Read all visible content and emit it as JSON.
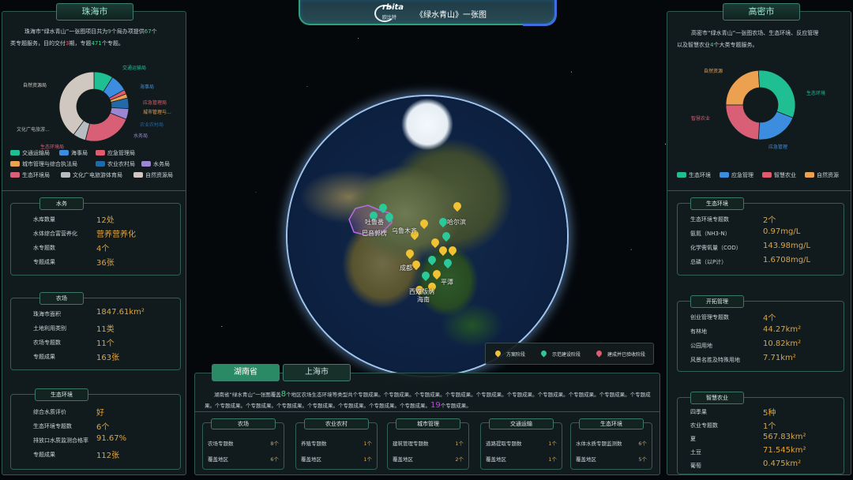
{
  "header": {
    "logo_text": "rbita",
    "logo_sub": "欧比特",
    "title": "《绿水青山》一张图"
  },
  "left": {
    "city_tab": "珠海市",
    "intro": {
      "p1": "珠海市“绿水青山”一张图项目共为",
      "n1": "9",
      "p2": "个局办项提供",
      "n2": "67",
      "p3": "个",
      "p4": "类专题服务，目的交付",
      "n3": "3",
      "p5": "期，专题",
      "n4": "471",
      "p6": "个专题。"
    },
    "pie": {
      "labels": [
        "交通运输局",
        "海事局",
        "应急管理局",
        "城市管理与...",
        "农业农村局",
        "水务局",
        "生态环境局",
        "文化广电旅游...",
        "自然资源局"
      ],
      "values": [
        9,
        8,
        2,
        2,
        5,
        5,
        23,
        6,
        40
      ],
      "colors": [
        "#1fbf93",
        "#3c8de0",
        "#e25b6d",
        "#eba14f",
        "#2169a8",
        "#9b86d4",
        "#d95f77",
        "#b7bdc0",
        "#cfc7c0"
      ]
    },
    "legend": [
      {
        "label": "交通运输局",
        "color": "#1fbf93"
      },
      {
        "label": "海事局",
        "color": "#3c8de0"
      },
      {
        "label": "应急管理局",
        "color": "#e25b6d"
      },
      {
        "label": "城市管理与综合执法局",
        "color": "#eba14f"
      },
      {
        "label": "农业农村局",
        "color": "#2169a8"
      },
      {
        "label": "水务局",
        "color": "#9b86d4"
      },
      {
        "label": "生态环境局",
        "color": "#d95f77"
      },
      {
        "label": "文化广电旅游体育局",
        "color": "#b7bdc0"
      },
      {
        "label": "自然资源局",
        "color": "#cfc7c0"
      }
    ],
    "water": {
      "title": "水务",
      "rows": [
        {
          "label": "水库数量",
          "value": "12处"
        },
        {
          "label": "水体综合富营养化",
          "value": "营养营养化"
        },
        {
          "label": "水专题数",
          "value": "4个"
        },
        {
          "label": "专题成果",
          "value": "36张"
        }
      ]
    },
    "farm": {
      "title": "农场",
      "rows": [
        {
          "label": "珠海市面积",
          "value": "1847.61km²"
        },
        {
          "label": "土地利用类别",
          "value": "11类"
        },
        {
          "label": "农场专题数",
          "value": "11个"
        },
        {
          "label": "专题成果",
          "value": "163张"
        }
      ]
    },
    "eco": {
      "title": "生态环境",
      "rows": [
        {
          "label": "综合水质评价",
          "value": "好"
        },
        {
          "label": "生态环境专题数",
          "value": "6个"
        },
        {
          "label": "排放口水质监测合格率",
          "value": "91.67%"
        },
        {
          "label": "专题成果",
          "value": "112张"
        }
      ]
    }
  },
  "right": {
    "city_tab": "高密市",
    "intro": {
      "p1": "高密市“绿水青山”一张图农场、生态环境、反应管理",
      "p2": "以及智慧农业",
      "n1": "4",
      "p3": "个大类专题服务。"
    },
    "pie": {
      "labels": [
        "自然资源",
        "生态环境",
        "应急管理",
        "智慧农业"
      ],
      "values": [
        24,
        32,
        20,
        24
      ],
      "colors": [
        "#eba14f",
        "#1fbf93",
        "#3c8de0",
        "#d95f77"
      ]
    },
    "legend": [
      {
        "label": "生态环境",
        "color": "#1fbf93"
      },
      {
        "label": "应急管理",
        "color": "#3c8de0"
      },
      {
        "label": "智慧农业",
        "color": "#e25b6d"
      },
      {
        "label": "自然资源",
        "color": "#eba14f"
      }
    ],
    "eco": {
      "title": "生态环境",
      "rows": [
        {
          "label": "生态环境专题数",
          "value": "2个"
        },
        {
          "label": "氨氮（NH3-N）",
          "value": "0.97mg/L"
        },
        {
          "label": "化学需氧量（COD）",
          "value": "143.98mg/L"
        },
        {
          "label": "总磷（以P计）",
          "value": "1.6708mg/L"
        }
      ]
    },
    "mgmt": {
      "title": "开拓管理",
      "rows": [
        {
          "label": "创业管理专题数",
          "value": "4个"
        },
        {
          "label": "有林地",
          "value": "44.27km²"
        },
        {
          "label": "公园用地",
          "value": "10.82km²"
        },
        {
          "label": "风景名胜及特殊用地",
          "value": "7.71km²"
        }
      ]
    },
    "agri": {
      "title": "智慧农业",
      "rows": [
        {
          "label": "四季果",
          "value": "5种"
        },
        {
          "label": "农业专题数",
          "value": "1个"
        },
        {
          "label": "夏",
          "value": "567.83km²"
        },
        {
          "label": "土豆",
          "value": "71.545km²"
        },
        {
          "label": "葡萄",
          "value": "0.475km²"
        }
      ]
    }
  },
  "map": {
    "cities": [
      "吐鲁番",
      "乌鲁木齐",
      "巴音郭楞",
      "哈尔滨",
      "成都",
      "西双版纳",
      "平潭",
      "海南"
    ],
    "legend": [
      "方案阶段",
      "示范建设阶段",
      "建成并已验收阶段"
    ]
  },
  "bottom": {
    "tabs": [
      "湖南省",
      "上海市"
    ],
    "intro": {
      "p1": "湖南省“绿水青山”一张图覆盖",
      "n1": "8",
      "p2": "个地区农场生态环境等类型共个专题成果。个专题成果。个专题成果。个专题成果。个专题成果。个专题成果。个专题成果。个专题成果。个专题成果。个专题成果。个专题成果。个专题成果。个专题成果。个专题成果。个专题成果。个专题成果。个专题成果。",
      "n2": "19",
      "p3": "个专题成果。"
    },
    "cards": [
      {
        "title": "农场",
        "rows": [
          {
            "label": "农场专题数",
            "value": "8个"
          },
          {
            "label": "覆盖地区",
            "value": "6个"
          }
        ]
      },
      {
        "title": "农业农村",
        "rows": [
          {
            "label": "养殖专题数",
            "value": "1个"
          },
          {
            "label": "覆盖地区",
            "value": "1个"
          }
        ]
      },
      {
        "title": "城市管理",
        "rows": [
          {
            "label": "建筑管理专题数",
            "value": "1个"
          },
          {
            "label": "覆盖地区",
            "value": "2个"
          }
        ]
      },
      {
        "title": "交通运输",
        "rows": [
          {
            "label": "道路提取专题数",
            "value": "1个"
          },
          {
            "label": "覆盖地区",
            "value": "1个"
          }
        ]
      },
      {
        "title": "生态环境",
        "rows": [
          {
            "label": "水体水质专题监测数",
            "value": "6个"
          },
          {
            "label": "覆盖地区",
            "value": "5个"
          }
        ]
      }
    ]
  }
}
